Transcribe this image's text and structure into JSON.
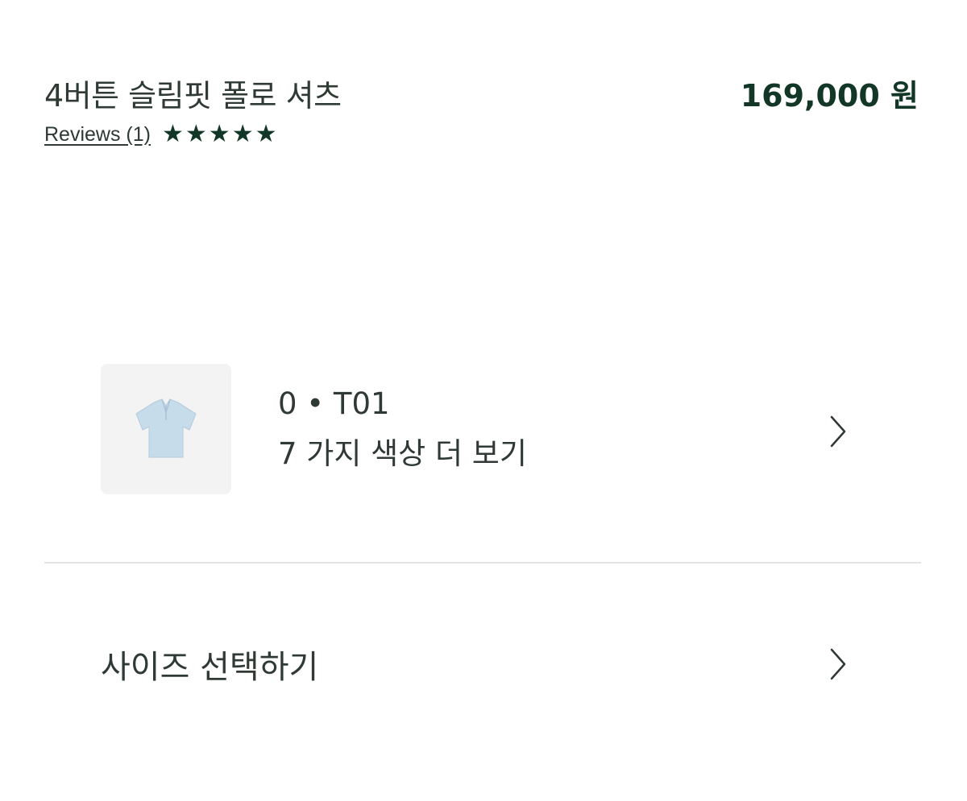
{
  "product": {
    "title": "4버튼 슬림핏 폴로 셔츠",
    "price": "169,000 원",
    "reviews_label": "Reviews (1)",
    "rating": 5,
    "rating_max": 5
  },
  "color_selector": {
    "code": "0 • T01",
    "more_label": "7 가지 색상 더 보기",
    "thumbnail_icon": "polo-shirt-icon",
    "swatch_color": "#c7dcea",
    "chevron_icon": "chevron-right-icon"
  },
  "size_selector": {
    "label": "사이즈 선택하기",
    "chevron_icon": "chevron-right-icon"
  },
  "colors": {
    "text": "#2f3a34",
    "accent": "#123726",
    "divider": "#e4e4e4"
  }
}
